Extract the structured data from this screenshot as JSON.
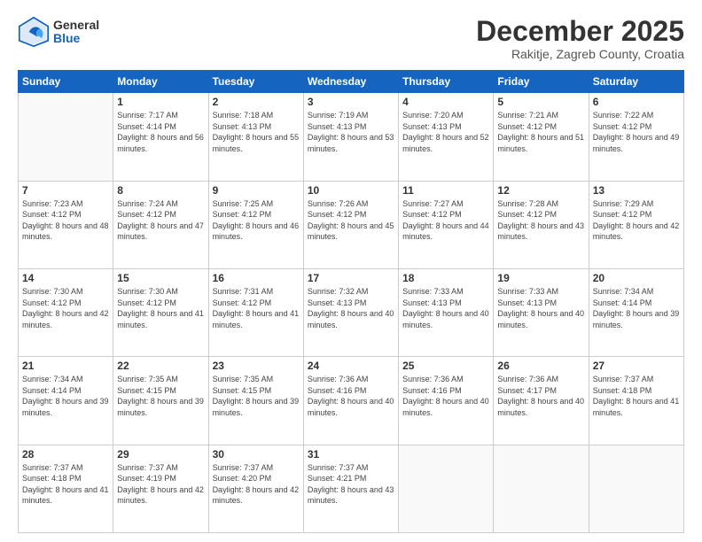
{
  "logo": {
    "line1": "General",
    "line2": "Blue"
  },
  "header": {
    "title": "December 2025",
    "subtitle": "Rakitje, Zagreb County, Croatia"
  },
  "days_of_week": [
    "Sunday",
    "Monday",
    "Tuesday",
    "Wednesday",
    "Thursday",
    "Friday",
    "Saturday"
  ],
  "weeks": [
    [
      {
        "day": "",
        "sunrise": "",
        "sunset": "",
        "daylight": "",
        "empty": true
      },
      {
        "day": "1",
        "sunrise": "Sunrise: 7:17 AM",
        "sunset": "Sunset: 4:14 PM",
        "daylight": "Daylight: 8 hours and 56 minutes."
      },
      {
        "day": "2",
        "sunrise": "Sunrise: 7:18 AM",
        "sunset": "Sunset: 4:13 PM",
        "daylight": "Daylight: 8 hours and 55 minutes."
      },
      {
        "day": "3",
        "sunrise": "Sunrise: 7:19 AM",
        "sunset": "Sunset: 4:13 PM",
        "daylight": "Daylight: 8 hours and 53 minutes."
      },
      {
        "day": "4",
        "sunrise": "Sunrise: 7:20 AM",
        "sunset": "Sunset: 4:13 PM",
        "daylight": "Daylight: 8 hours and 52 minutes."
      },
      {
        "day": "5",
        "sunrise": "Sunrise: 7:21 AM",
        "sunset": "Sunset: 4:12 PM",
        "daylight": "Daylight: 8 hours and 51 minutes."
      },
      {
        "day": "6",
        "sunrise": "Sunrise: 7:22 AM",
        "sunset": "Sunset: 4:12 PM",
        "daylight": "Daylight: 8 hours and 49 minutes."
      }
    ],
    [
      {
        "day": "7",
        "sunrise": "Sunrise: 7:23 AM",
        "sunset": "Sunset: 4:12 PM",
        "daylight": "Daylight: 8 hours and 48 minutes."
      },
      {
        "day": "8",
        "sunrise": "Sunrise: 7:24 AM",
        "sunset": "Sunset: 4:12 PM",
        "daylight": "Daylight: 8 hours and 47 minutes."
      },
      {
        "day": "9",
        "sunrise": "Sunrise: 7:25 AM",
        "sunset": "Sunset: 4:12 PM",
        "daylight": "Daylight: 8 hours and 46 minutes."
      },
      {
        "day": "10",
        "sunrise": "Sunrise: 7:26 AM",
        "sunset": "Sunset: 4:12 PM",
        "daylight": "Daylight: 8 hours and 45 minutes."
      },
      {
        "day": "11",
        "sunrise": "Sunrise: 7:27 AM",
        "sunset": "Sunset: 4:12 PM",
        "daylight": "Daylight: 8 hours and 44 minutes."
      },
      {
        "day": "12",
        "sunrise": "Sunrise: 7:28 AM",
        "sunset": "Sunset: 4:12 PM",
        "daylight": "Daylight: 8 hours and 43 minutes."
      },
      {
        "day": "13",
        "sunrise": "Sunrise: 7:29 AM",
        "sunset": "Sunset: 4:12 PM",
        "daylight": "Daylight: 8 hours and 42 minutes."
      }
    ],
    [
      {
        "day": "14",
        "sunrise": "Sunrise: 7:30 AM",
        "sunset": "Sunset: 4:12 PM",
        "daylight": "Daylight: 8 hours and 42 minutes."
      },
      {
        "day": "15",
        "sunrise": "Sunrise: 7:30 AM",
        "sunset": "Sunset: 4:12 PM",
        "daylight": "Daylight: 8 hours and 41 minutes."
      },
      {
        "day": "16",
        "sunrise": "Sunrise: 7:31 AM",
        "sunset": "Sunset: 4:12 PM",
        "daylight": "Daylight: 8 hours and 41 minutes."
      },
      {
        "day": "17",
        "sunrise": "Sunrise: 7:32 AM",
        "sunset": "Sunset: 4:13 PM",
        "daylight": "Daylight: 8 hours and 40 minutes."
      },
      {
        "day": "18",
        "sunrise": "Sunrise: 7:33 AM",
        "sunset": "Sunset: 4:13 PM",
        "daylight": "Daylight: 8 hours and 40 minutes."
      },
      {
        "day": "19",
        "sunrise": "Sunrise: 7:33 AM",
        "sunset": "Sunset: 4:13 PM",
        "daylight": "Daylight: 8 hours and 40 minutes."
      },
      {
        "day": "20",
        "sunrise": "Sunrise: 7:34 AM",
        "sunset": "Sunset: 4:14 PM",
        "daylight": "Daylight: 8 hours and 39 minutes."
      }
    ],
    [
      {
        "day": "21",
        "sunrise": "Sunrise: 7:34 AM",
        "sunset": "Sunset: 4:14 PM",
        "daylight": "Daylight: 8 hours and 39 minutes."
      },
      {
        "day": "22",
        "sunrise": "Sunrise: 7:35 AM",
        "sunset": "Sunset: 4:15 PM",
        "daylight": "Daylight: 8 hours and 39 minutes."
      },
      {
        "day": "23",
        "sunrise": "Sunrise: 7:35 AM",
        "sunset": "Sunset: 4:15 PM",
        "daylight": "Daylight: 8 hours and 39 minutes."
      },
      {
        "day": "24",
        "sunrise": "Sunrise: 7:36 AM",
        "sunset": "Sunset: 4:16 PM",
        "daylight": "Daylight: 8 hours and 40 minutes."
      },
      {
        "day": "25",
        "sunrise": "Sunrise: 7:36 AM",
        "sunset": "Sunset: 4:16 PM",
        "daylight": "Daylight: 8 hours and 40 minutes."
      },
      {
        "day": "26",
        "sunrise": "Sunrise: 7:36 AM",
        "sunset": "Sunset: 4:17 PM",
        "daylight": "Daylight: 8 hours and 40 minutes."
      },
      {
        "day": "27",
        "sunrise": "Sunrise: 7:37 AM",
        "sunset": "Sunset: 4:18 PM",
        "daylight": "Daylight: 8 hours and 41 minutes."
      }
    ],
    [
      {
        "day": "28",
        "sunrise": "Sunrise: 7:37 AM",
        "sunset": "Sunset: 4:18 PM",
        "daylight": "Daylight: 8 hours and 41 minutes."
      },
      {
        "day": "29",
        "sunrise": "Sunrise: 7:37 AM",
        "sunset": "Sunset: 4:19 PM",
        "daylight": "Daylight: 8 hours and 42 minutes."
      },
      {
        "day": "30",
        "sunrise": "Sunrise: 7:37 AM",
        "sunset": "Sunset: 4:20 PM",
        "daylight": "Daylight: 8 hours and 42 minutes."
      },
      {
        "day": "31",
        "sunrise": "Sunrise: 7:37 AM",
        "sunset": "Sunset: 4:21 PM",
        "daylight": "Daylight: 8 hours and 43 minutes."
      },
      {
        "day": "",
        "sunrise": "",
        "sunset": "",
        "daylight": "",
        "empty": true
      },
      {
        "day": "",
        "sunrise": "",
        "sunset": "",
        "daylight": "",
        "empty": true
      },
      {
        "day": "",
        "sunrise": "",
        "sunset": "",
        "daylight": "",
        "empty": true
      }
    ]
  ]
}
